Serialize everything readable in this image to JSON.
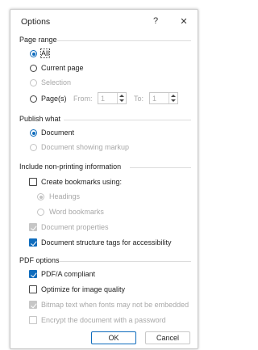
{
  "dialog": {
    "title": "Options",
    "help_glyph": "?",
    "close_glyph": "✕"
  },
  "page_range": {
    "heading": "Page range",
    "options": {
      "all": "All",
      "current": "Current page",
      "selection": "Selection",
      "pages": "Page(s)"
    },
    "from_label": "From:",
    "from_value": "1",
    "to_label": "To:",
    "to_value": "1"
  },
  "publish_what": {
    "heading": "Publish what",
    "document": "Document",
    "document_markup": "Document showing markup"
  },
  "non_printing": {
    "heading": "Include non-printing information",
    "create_bookmarks": "Create bookmarks using:",
    "headings": "Headings",
    "word_bookmarks": "Word bookmarks",
    "document_properties": "Document properties",
    "structure_tags": "Document structure tags for accessibility"
  },
  "pdf_options": {
    "heading": "PDF options",
    "pdfa": "PDF/A compliant",
    "optimize_quality": "Optimize for image quality",
    "bitmap_text": "Bitmap text when fonts may not be embedded",
    "encrypt": "Encrypt the document with a password"
  },
  "buttons": {
    "ok": "OK",
    "cancel": "Cancel"
  },
  "colors": {
    "accent": "#0f6cbd",
    "disabled": "#a8a8a8"
  }
}
